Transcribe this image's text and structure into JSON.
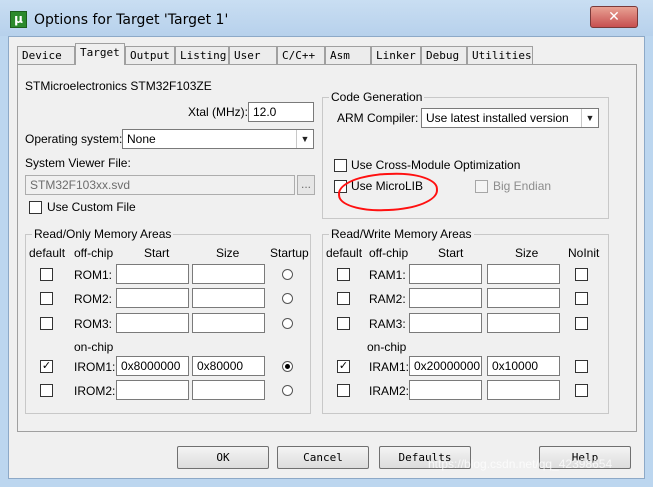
{
  "window": {
    "title": "Options for Target 'Target 1'",
    "close_glyph": "✕",
    "icon_letter": "μ"
  },
  "tabs": [
    {
      "label": "Device"
    },
    {
      "label": "Target",
      "active": true
    },
    {
      "label": "Output"
    },
    {
      "label": "Listing"
    },
    {
      "label": "User"
    },
    {
      "label": "C/C++"
    },
    {
      "label": "Asm"
    },
    {
      "label": "Linker"
    },
    {
      "label": "Debug"
    },
    {
      "label": "Utilities"
    }
  ],
  "target": {
    "device_name": "STMicroelectronics STM32F103ZE",
    "xtal_label": "Xtal (MHz):",
    "xtal_value": "12.0",
    "os_label": "Operating system:",
    "os_value": "None",
    "svd_label": "System Viewer File:",
    "svd_value": "STM32F103xx.svd",
    "browse_label": "...",
    "custom_file_label": "Use Custom File"
  },
  "code_gen": {
    "title": "Code Generation",
    "compiler_label": "ARM Compiler:",
    "compiler_value": "Use latest installed version",
    "cross_module_label": "Use Cross-Module Optimization",
    "microlib_label": "Use MicroLIB",
    "big_endian_label": "Big Endian"
  },
  "rom": {
    "title": "Read/Only Memory Areas",
    "headers": {
      "default": "default",
      "offchip": "off-chip",
      "start": "Start",
      "size": "Size",
      "startup": "Startup"
    },
    "onchip_label": "on-chip",
    "rows": [
      {
        "label": "ROM1:",
        "start": "",
        "size": "",
        "default": false,
        "startup": false
      },
      {
        "label": "ROM2:",
        "start": "",
        "size": "",
        "default": false,
        "startup": false
      },
      {
        "label": "ROM3:",
        "start": "",
        "size": "",
        "default": false,
        "startup": false
      },
      {
        "label": "IROM1:",
        "start": "0x8000000",
        "size": "0x80000",
        "default": true,
        "startup": true
      },
      {
        "label": "IROM2:",
        "start": "",
        "size": "",
        "default": false,
        "startup": false
      }
    ]
  },
  "ram": {
    "title": "Read/Write Memory Areas",
    "headers": {
      "default": "default",
      "offchip": "off-chip",
      "start": "Start",
      "size": "Size",
      "noinit": "NoInit"
    },
    "onchip_label": "on-chip",
    "rows": [
      {
        "label": "RAM1:",
        "start": "",
        "size": "",
        "default": false
      },
      {
        "label": "RAM2:",
        "start": "",
        "size": "",
        "default": false
      },
      {
        "label": "RAM3:",
        "start": "",
        "size": "",
        "default": false
      },
      {
        "label": "IRAM1:",
        "start": "0x20000000",
        "size": "0x10000",
        "default": true
      },
      {
        "label": "IRAM2:",
        "start": "",
        "size": "",
        "default": false
      }
    ]
  },
  "buttons": {
    "ok": "OK",
    "cancel": "Cancel",
    "defaults": "Defaults",
    "help": "Help"
  },
  "check_glyph": "✓",
  "watermark": "https://blog.csdn.net/qq_42398654"
}
